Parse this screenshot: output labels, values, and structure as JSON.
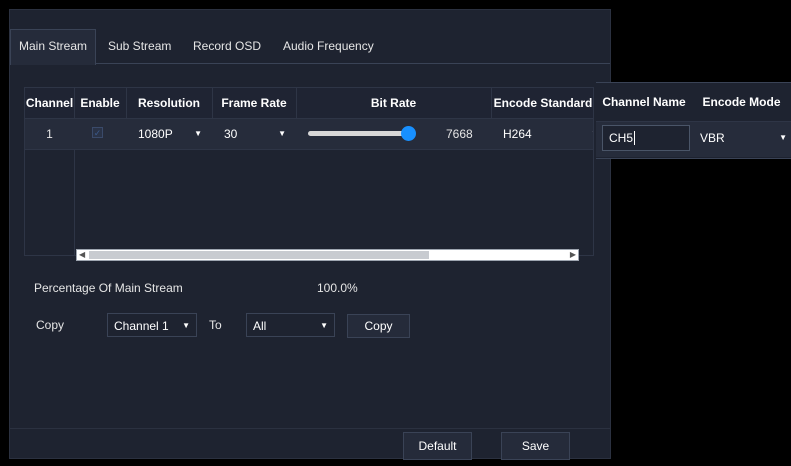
{
  "tabs": [
    {
      "label": "Main Stream",
      "active": true
    },
    {
      "label": "Sub Stream"
    },
    {
      "label": "Record OSD"
    },
    {
      "label": "Audio Frequency"
    }
  ],
  "table": {
    "headers": {
      "channel": "Channel",
      "enable": "Enable",
      "resolution": "Resolution",
      "frame_rate": "Frame Rate",
      "bit_rate": "Bit Rate",
      "encode_standard": "Encode Standard",
      "channel_name": "Channel Name",
      "encode_mode": "Encode Mode"
    },
    "rows": [
      {
        "channel": "1",
        "enable": true,
        "resolution": "1080P",
        "frame_rate": "30",
        "bit_rate": "7668",
        "bit_rate_slider_fraction": 1.0,
        "encode_standard": "H264",
        "channel_name": "CH5",
        "encode_mode": "VBR"
      }
    ]
  },
  "percentage": {
    "label": "Percentage Of Main Stream",
    "value": "100.0%"
  },
  "copy": {
    "label": "Copy",
    "from_value": "Channel 1",
    "to_label": "To",
    "to_value": "All",
    "button_label": "Copy"
  },
  "footer": {
    "default_label": "Default",
    "save_label": "Save"
  },
  "colors": {
    "accent": "#1890ff",
    "panel_bg": "#1e2330",
    "page_bg": "#000000"
  }
}
